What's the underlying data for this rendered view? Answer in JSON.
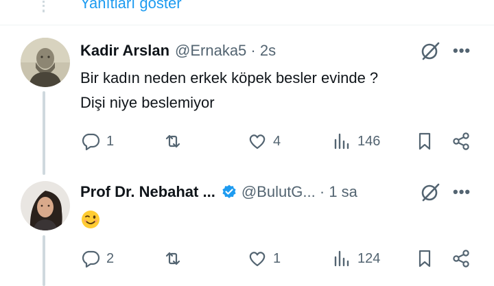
{
  "top": {
    "show_replies": "Yanıtları göster"
  },
  "tweets": [
    {
      "name": "Kadir Arslan",
      "handle": "@Ernaka5",
      "sep": " · ",
      "time": "2s",
      "text_line1": "Bir kadın neden erkek köpek besler evinde ?",
      "text_line2": "Dişi niye beslemiyor",
      "stats": {
        "replies": "1",
        "retweets": "",
        "likes": "4",
        "views": "146"
      }
    },
    {
      "name": "Prof Dr. Nebahat ...",
      "handle": "@BulutG...",
      "sep": " · ",
      "time": "1 sa",
      "emoji": "winking-face",
      "stats": {
        "replies": "2",
        "retweets": "",
        "likes": "1",
        "views": "124"
      }
    }
  ],
  "colors": {
    "accent": "#1d9bf0",
    "muted": "#536471",
    "text": "#0f1419",
    "line": "#cfd9de"
  }
}
